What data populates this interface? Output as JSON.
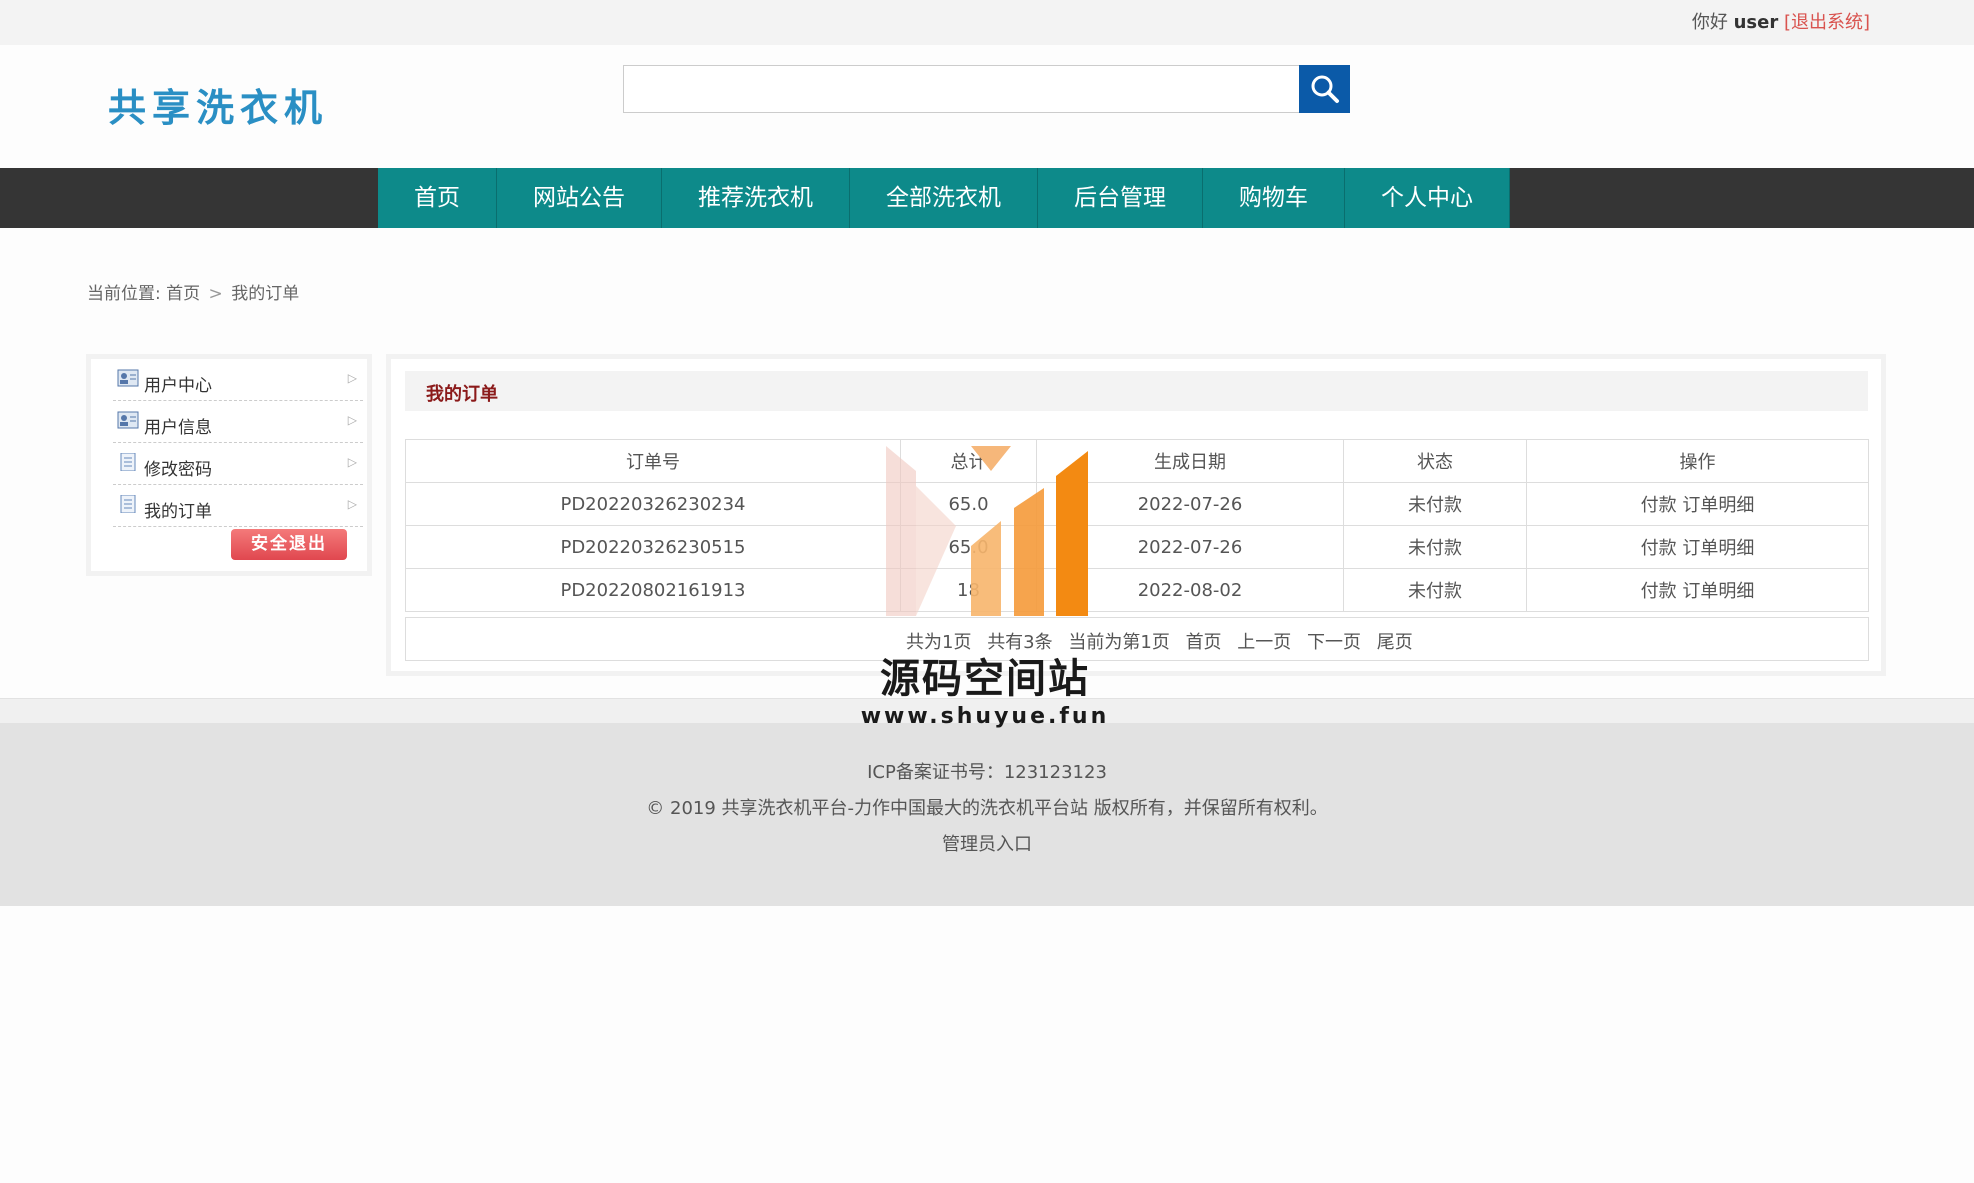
{
  "topbar": {
    "greeting": "你好",
    "username": "user",
    "logout_label": "[退出系统]"
  },
  "header": {
    "logo_text": "共享洗衣机",
    "search_placeholder": "",
    "search_icon": "search-icon"
  },
  "nav": {
    "items": [
      "首页",
      "网站公告",
      "推荐洗衣机",
      "全部洗衣机",
      "后台管理",
      "购物车",
      "个人中心"
    ]
  },
  "breadcrumb": {
    "prefix": "当前位置:",
    "home": "首页",
    "separator": ">",
    "current": "我的订单"
  },
  "sidebar": {
    "items": [
      {
        "label": "用户中心",
        "icon": "user-card-icon"
      },
      {
        "label": "用户信息",
        "icon": "user-card-icon"
      },
      {
        "label": "修改密码",
        "icon": "document-icon"
      },
      {
        "label": "我的订单",
        "icon": "document-icon"
      }
    ],
    "logout_button": "安全退出"
  },
  "orders": {
    "title": "我的订单",
    "columns": [
      "订单号",
      "总计",
      "生成日期",
      "状态",
      "操作"
    ],
    "rows": [
      {
        "id": "PD20220326230234",
        "total": "65.0",
        "date": "2022-07-26",
        "status": "未付款",
        "pay": "付款",
        "detail": "订单明细"
      },
      {
        "id": "PD20220326230515",
        "total": "65.0",
        "date": "2022-07-26",
        "status": "未付款",
        "pay": "付款",
        "detail": "订单明细"
      },
      {
        "id": "PD20220802161913",
        "total": "18",
        "date": "2022-08-02",
        "status": "未付款",
        "pay": "付款",
        "detail": "订单明细"
      }
    ],
    "pager": {
      "total_pages": "共为1页",
      "total_items": "共有3条",
      "current_page": "当前为第1页",
      "first": "首页",
      "prev": "上一页",
      "next": "下一页",
      "last": "尾页"
    }
  },
  "footer": {
    "icp": "ICP备案证书号：123123123",
    "copyright": "© 2019 共享洗衣机平台-力作中国最大的洗衣机平台站 版权所有，并保留所有权利。",
    "admin_link": "管理员入口"
  },
  "watermark": {
    "title": "源码空间站",
    "url": "www.shuyue.fun"
  },
  "colors": {
    "nav_bg": "#0d8a8a",
    "nav_bar": "#353535",
    "search_btn": "#0b5aa8",
    "logo": "#2a8fc4",
    "title_red": "#8b1a1a",
    "logout_red": "#d9534f"
  }
}
